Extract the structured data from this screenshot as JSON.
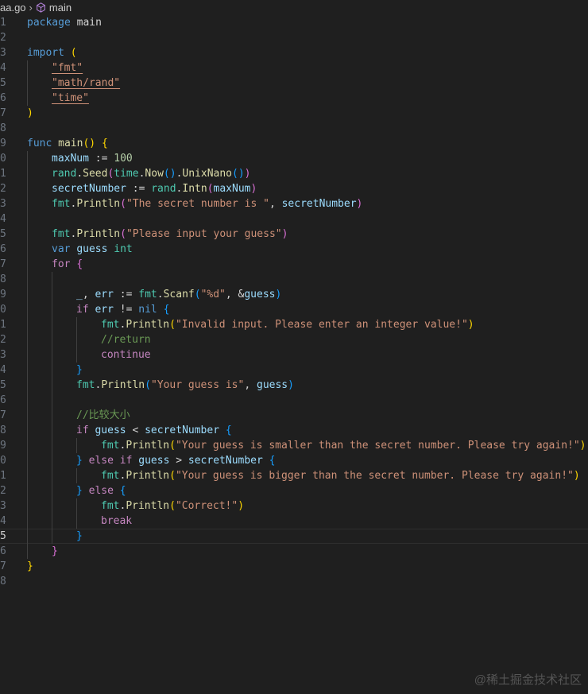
{
  "breadcrumb": {
    "file": "aa.go",
    "symbol": "main",
    "symbol_icon": "cube-icon"
  },
  "current_line": 35,
  "watermark": "@稀土掘金技术社区",
  "lines": [
    {
      "n": "1",
      "t": [
        [
          "package",
          "kw"
        ],
        [
          " main",
          "pl"
        ]
      ]
    },
    {
      "n": "2",
      "t": []
    },
    {
      "n": "3",
      "t": [
        [
          "import",
          "kw"
        ],
        [
          " ",
          "pl"
        ],
        [
          "(",
          "b1"
        ]
      ]
    },
    {
      "n": "4",
      "i": 1,
      "t": [
        [
          "\"fmt\"",
          "str ul"
        ]
      ]
    },
    {
      "n": "5",
      "i": 1,
      "t": [
        [
          "\"math/rand\"",
          "str ul"
        ]
      ]
    },
    {
      "n": "6",
      "i": 1,
      "t": [
        [
          "\"time\"",
          "str ul"
        ]
      ]
    },
    {
      "n": "7",
      "t": [
        [
          ")",
          "b1"
        ]
      ]
    },
    {
      "n": "8",
      "t": []
    },
    {
      "n": "9",
      "t": [
        [
          "func",
          "kw"
        ],
        [
          " ",
          "pl"
        ],
        [
          "main",
          "fn"
        ],
        [
          "()",
          "b1"
        ],
        [
          " ",
          "pl"
        ],
        [
          "{",
          "b1"
        ]
      ]
    },
    {
      "n": "0",
      "i": 1,
      "t": [
        [
          "maxNum",
          "var"
        ],
        [
          " := ",
          "pl"
        ],
        [
          "100",
          "num"
        ]
      ]
    },
    {
      "n": "1",
      "i": 1,
      "t": [
        [
          "rand",
          "type"
        ],
        [
          ".",
          "pl"
        ],
        [
          "Seed",
          "fn"
        ],
        [
          "(",
          "b2"
        ],
        [
          "time",
          "type"
        ],
        [
          ".",
          "pl"
        ],
        [
          "Now",
          "fn"
        ],
        [
          "()",
          "b3"
        ],
        [
          ".",
          "pl"
        ],
        [
          "UnixNano",
          "fn"
        ],
        [
          "()",
          "b3"
        ],
        [
          ")",
          "b2"
        ]
      ]
    },
    {
      "n": "2",
      "i": 1,
      "t": [
        [
          "secretNumber",
          "var"
        ],
        [
          " := ",
          "pl"
        ],
        [
          "rand",
          "type"
        ],
        [
          ".",
          "pl"
        ],
        [
          "Intn",
          "fn"
        ],
        [
          "(",
          "b2"
        ],
        [
          "maxNum",
          "var"
        ],
        [
          ")",
          "b2"
        ]
      ]
    },
    {
      "n": "3",
      "i": 1,
      "t": [
        [
          "fmt",
          "type"
        ],
        [
          ".",
          "pl"
        ],
        [
          "Println",
          "fn"
        ],
        [
          "(",
          "b2"
        ],
        [
          "\"The secret number is \"",
          "str"
        ],
        [
          ", ",
          "pl"
        ],
        [
          "secretNumber",
          "var"
        ],
        [
          ")",
          "b2"
        ]
      ]
    },
    {
      "n": "4",
      "i": 1,
      "t": []
    },
    {
      "n": "5",
      "i": 1,
      "t": [
        [
          "fmt",
          "type"
        ],
        [
          ".",
          "pl"
        ],
        [
          "Println",
          "fn"
        ],
        [
          "(",
          "b2"
        ],
        [
          "\"Please input your guess\"",
          "str"
        ],
        [
          ")",
          "b2"
        ]
      ]
    },
    {
      "n": "6",
      "i": 1,
      "t": [
        [
          "var",
          "kw"
        ],
        [
          " ",
          "pl"
        ],
        [
          "guess",
          "var"
        ],
        [
          " ",
          "pl"
        ],
        [
          "int",
          "type"
        ]
      ]
    },
    {
      "n": "7",
      "i": 1,
      "t": [
        [
          "for",
          "ctl"
        ],
        [
          " ",
          "pl"
        ],
        [
          "{",
          "b2"
        ]
      ]
    },
    {
      "n": "8",
      "i": 2,
      "t": []
    },
    {
      "n": "9",
      "i": 2,
      "t": [
        [
          "_",
          "var"
        ],
        [
          ", ",
          "pl"
        ],
        [
          "err",
          "var"
        ],
        [
          " := ",
          "pl"
        ],
        [
          "fmt",
          "type"
        ],
        [
          ".",
          "pl"
        ],
        [
          "Scanf",
          "fn"
        ],
        [
          "(",
          "b3"
        ],
        [
          "\"%d\"",
          "str"
        ],
        [
          ", &",
          "pl"
        ],
        [
          "guess",
          "var"
        ],
        [
          ")",
          "b3"
        ]
      ]
    },
    {
      "n": "0",
      "i": 2,
      "t": [
        [
          "if",
          "ctl"
        ],
        [
          " ",
          "pl"
        ],
        [
          "err",
          "var"
        ],
        [
          " != ",
          "pl"
        ],
        [
          "nil",
          "kw"
        ],
        [
          " ",
          "pl"
        ],
        [
          "{",
          "b3"
        ]
      ]
    },
    {
      "n": "1",
      "i": 3,
      "t": [
        [
          "fmt",
          "type"
        ],
        [
          ".",
          "pl"
        ],
        [
          "Println",
          "fn"
        ],
        [
          "(",
          "b1"
        ],
        [
          "\"Invalid input. Please enter an integer value!\"",
          "str"
        ],
        [
          ")",
          "b1"
        ]
      ]
    },
    {
      "n": "2",
      "i": 3,
      "t": [
        [
          "//return",
          "cm"
        ]
      ]
    },
    {
      "n": "3",
      "i": 3,
      "t": [
        [
          "continue",
          "ctl"
        ]
      ]
    },
    {
      "n": "4",
      "i": 2,
      "t": [
        [
          "}",
          "b3"
        ]
      ]
    },
    {
      "n": "5",
      "i": 2,
      "t": [
        [
          "fmt",
          "type"
        ],
        [
          ".",
          "pl"
        ],
        [
          "Println",
          "fn"
        ],
        [
          "(",
          "b3"
        ],
        [
          "\"Your guess is\"",
          "str"
        ],
        [
          ", ",
          "pl"
        ],
        [
          "guess",
          "var"
        ],
        [
          ")",
          "b3"
        ]
      ]
    },
    {
      "n": "6",
      "i": 2,
      "t": []
    },
    {
      "n": "7",
      "i": 2,
      "t": [
        [
          "//比较大小",
          "cm"
        ]
      ]
    },
    {
      "n": "8",
      "i": 2,
      "t": [
        [
          "if",
          "ctl"
        ],
        [
          " ",
          "pl"
        ],
        [
          "guess",
          "var"
        ],
        [
          " < ",
          "pl"
        ],
        [
          "secretNumber",
          "var"
        ],
        [
          " ",
          "pl"
        ],
        [
          "{",
          "b3"
        ]
      ]
    },
    {
      "n": "9",
      "i": 3,
      "t": [
        [
          "fmt",
          "type"
        ],
        [
          ".",
          "pl"
        ],
        [
          "Println",
          "fn"
        ],
        [
          "(",
          "b1"
        ],
        [
          "\"Your guess is smaller than the secret number. Please try again!\"",
          "str"
        ],
        [
          ")",
          "b1"
        ]
      ]
    },
    {
      "n": "0",
      "i": 2,
      "t": [
        [
          "}",
          "b3"
        ],
        [
          " ",
          "pl"
        ],
        [
          "else",
          "ctl"
        ],
        [
          " ",
          "pl"
        ],
        [
          "if",
          "ctl"
        ],
        [
          " ",
          "pl"
        ],
        [
          "guess",
          "var"
        ],
        [
          " > ",
          "pl"
        ],
        [
          "secretNumber",
          "var"
        ],
        [
          " ",
          "pl"
        ],
        [
          "{",
          "b3"
        ]
      ]
    },
    {
      "n": "1",
      "i": 3,
      "t": [
        [
          "fmt",
          "type"
        ],
        [
          ".",
          "pl"
        ],
        [
          "Println",
          "fn"
        ],
        [
          "(",
          "b1"
        ],
        [
          "\"Your guess is bigger than the secret number. Please try again!\"",
          "str"
        ],
        [
          ")",
          "b1"
        ]
      ]
    },
    {
      "n": "2",
      "i": 2,
      "t": [
        [
          "}",
          "b3"
        ],
        [
          " ",
          "pl"
        ],
        [
          "else",
          "ctl"
        ],
        [
          " ",
          "pl"
        ],
        [
          "{",
          "b3"
        ]
      ]
    },
    {
      "n": "3",
      "i": 3,
      "t": [
        [
          "fmt",
          "type"
        ],
        [
          ".",
          "pl"
        ],
        [
          "Println",
          "fn"
        ],
        [
          "(",
          "b1"
        ],
        [
          "\"Correct!\"",
          "str"
        ],
        [
          ")",
          "b1"
        ]
      ]
    },
    {
      "n": "4",
      "i": 3,
      "t": [
        [
          "break",
          "ctl"
        ]
      ]
    },
    {
      "n": "5",
      "i": 2,
      "t": [
        [
          "}",
          "b3"
        ]
      ]
    },
    {
      "n": "6",
      "i": 1,
      "t": [
        [
          "}",
          "b2"
        ]
      ]
    },
    {
      "n": "7",
      "t": [
        [
          "}",
          "b1"
        ]
      ]
    },
    {
      "n": "8",
      "t": []
    }
  ]
}
